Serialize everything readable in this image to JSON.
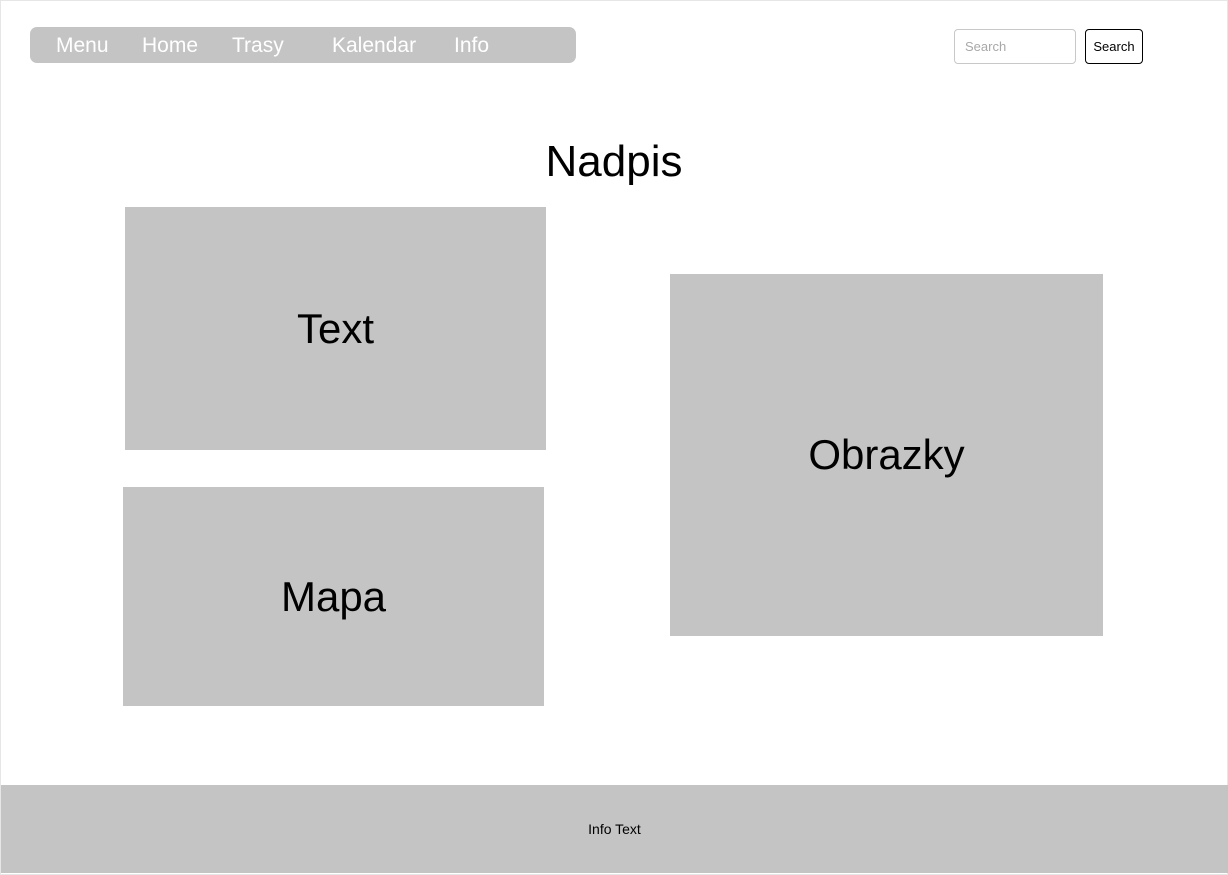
{
  "nav": {
    "items": [
      {
        "label": "Menu"
      },
      {
        "label": "Home"
      },
      {
        "label": "Trasy"
      },
      {
        "label": "Kalendar"
      },
      {
        "label": "Info"
      }
    ]
  },
  "search": {
    "placeholder": "Search",
    "value": "",
    "button_label": "Search"
  },
  "main": {
    "title": "Nadpis",
    "panels": {
      "text": "Text",
      "map": "Mapa",
      "images": "Obrazky"
    }
  },
  "footer": {
    "text": "Info Text"
  },
  "colors": {
    "placeholder_block": "#c4c4c4",
    "nav_text": "#ffffff",
    "background": "#ffffff"
  }
}
